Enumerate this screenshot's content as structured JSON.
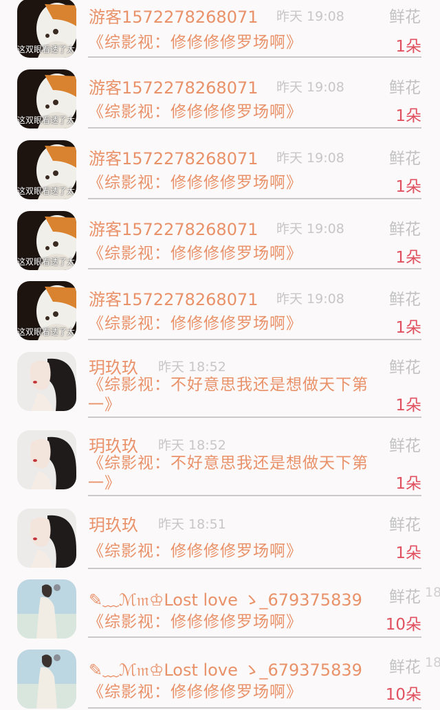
{
  "gifts": [
    {
      "avatar": "cat-avatar",
      "avatar_caption": "这双眼看透了太多",
      "name": "游客1572278268071",
      "time": "昨天 19:08",
      "type": "鲜花",
      "book": "《综影视：修修修修罗场啊》",
      "count": "1朵"
    },
    {
      "avatar": "cat-avatar",
      "avatar_caption": "这双眼看透了太多",
      "name": "游客1572278268071",
      "time": "昨天 19:08",
      "type": "鲜花",
      "book": "《综影视：修修修修罗场啊》",
      "count": "1朵"
    },
    {
      "avatar": "cat-avatar",
      "avatar_caption": "这双眼看透了太多",
      "name": "游客1572278268071",
      "time": "昨天 19:08",
      "type": "鲜花",
      "book": "《综影视：修修修修罗场啊》",
      "count": "1朵"
    },
    {
      "avatar": "cat-avatar",
      "avatar_caption": "这双眼看透了太多",
      "name": "游客1572278268071",
      "time": "昨天 19:08",
      "type": "鲜花",
      "book": "《综影视：修修修修罗场啊》",
      "count": "1朵"
    },
    {
      "avatar": "cat-avatar",
      "avatar_caption": "这双眼看透了太多",
      "name": "游客1572278268071",
      "time": "昨天 19:08",
      "type": "鲜花",
      "book": "《综影视：修修修修罗场啊》",
      "count": "1朵"
    },
    {
      "avatar": "woman-avatar",
      "avatar_caption": "",
      "name": "玥玖玖",
      "time": "昨天 18:52",
      "type": "鲜花",
      "book": "《综影视：不好意思我还是想做天下第一》",
      "count": "1朵"
    },
    {
      "avatar": "woman-avatar",
      "avatar_caption": "",
      "name": "玥玖玖",
      "time": "昨天 18:52",
      "type": "鲜花",
      "book": "《综影视：不好意思我还是想做天下第一》",
      "count": "1朵"
    },
    {
      "avatar": "woman-avatar",
      "avatar_caption": "",
      "name": "玥玖玖",
      "time": "昨天 18:51",
      "type": "鲜花",
      "book": "《综影视：修修修修罗场啊》",
      "count": "1朵"
    },
    {
      "avatar": "sky-girl-avatar",
      "avatar_caption": "",
      "name": "✎﹏ℳ𝔪♔Lost love ゝ_679375839",
      "time": "18",
      "type": "鲜花",
      "book": "《综影视：修修修修罗场啊》",
      "count": "10朵"
    },
    {
      "avatar": "sky-girl-avatar",
      "avatar_caption": "",
      "name": "✎﹏ℳ𝔪♔Lost love ゝ_679375839",
      "time": "18",
      "type": "鲜花",
      "book": "《综影视：修修修修罗场啊》",
      "count": "10朵"
    }
  ],
  "colors": {
    "accent": "#e9926a",
    "count": "#e0505e",
    "muted": "#c2c2c2",
    "background": "#fbf9fa"
  }
}
